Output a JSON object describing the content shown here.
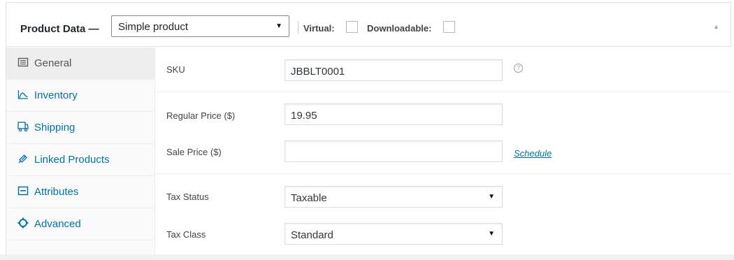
{
  "header": {
    "title": "Product Data —",
    "product_type": "Simple product",
    "virtual_label": "Virtual:",
    "downloadable_label": "Downloadable:"
  },
  "tabs": [
    {
      "label": "General",
      "icon": "list-icon",
      "active": true
    },
    {
      "label": "Inventory",
      "icon": "chart-icon",
      "active": false
    },
    {
      "label": "Shipping",
      "icon": "truck-icon",
      "active": false
    },
    {
      "label": "Linked Products",
      "icon": "link-icon",
      "active": false
    },
    {
      "label": "Attributes",
      "icon": "attributes-icon",
      "active": false
    },
    {
      "label": "Advanced",
      "icon": "gear-icon",
      "active": false
    }
  ],
  "fields": {
    "sku_label": "SKU",
    "sku_value": "JBBLT0001",
    "regular_price_label": "Regular Price ($)",
    "regular_price_value": "19.95",
    "sale_price_label": "Sale Price ($)",
    "sale_price_value": "",
    "schedule_link": "Schedule",
    "tax_status_label": "Tax Status",
    "tax_status_value": "Taxable",
    "tax_class_label": "Tax Class",
    "tax_class_value": "Standard"
  },
  "colors": {
    "link": "#0073aa",
    "active_tab_bg": "#eeeeee"
  }
}
